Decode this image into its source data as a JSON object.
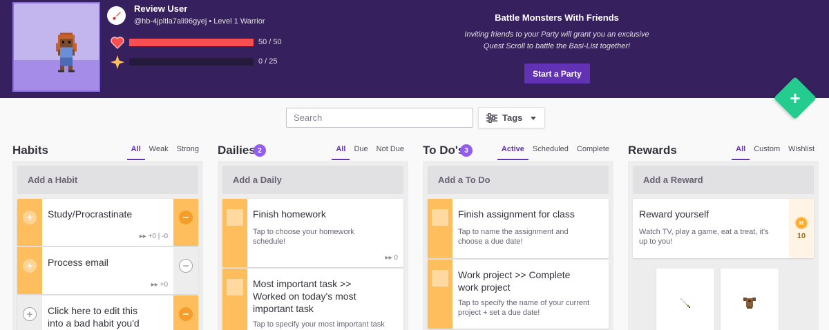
{
  "header": {
    "user_name": "Review User",
    "user_sub": "@hb-4jpltla7ali96gyej • Level 1 Warrior",
    "hp": {
      "text": "50 / 50",
      "fraction": 1.0,
      "color": "#f74e52"
    },
    "xp": {
      "text": "0 / 25",
      "fraction": 0.0,
      "color": "#ffbe5d"
    },
    "party_title": "Battle Monsters With Friends",
    "party_desc_line1": "Inviting friends to your Party will grant you an exclusive",
    "party_desc_line2": "Quest Scroll to battle the Basi-List together!",
    "party_button": "Start a Party",
    "fab_label": "+"
  },
  "toolbar": {
    "search_placeholder": "Search",
    "tags_label": "Tags"
  },
  "habits": {
    "title": "Habits",
    "filters": [
      "All",
      "Weak",
      "Strong"
    ],
    "add_label": "Add a Habit",
    "items": [
      {
        "title": "Study/Procrastinate",
        "meta": "▸▸ +0 | -0"
      },
      {
        "title": "Process email",
        "meta": "▸▸ +0"
      },
      {
        "title_line1": "Click here to edit this",
        "title_line2": "into a bad habit you'd"
      }
    ]
  },
  "dailies": {
    "title": "Dailies",
    "badge": "2",
    "filters": [
      "All",
      "Due",
      "Not Due"
    ],
    "add_label": "Add a Daily",
    "items": [
      {
        "title": "Finish homework",
        "notes_line1": "Tap to choose your homework",
        "notes_line2": "schedule!",
        "meta": "▸▸ 0"
      },
      {
        "title_line1": "Most important task >>",
        "title_line2": "Worked on today's most",
        "title_line3": "important task",
        "notes_line1": "Tap to specify your most important task"
      }
    ]
  },
  "todos": {
    "title": "To Do's",
    "badge": "3",
    "filters": [
      "Active",
      "Scheduled",
      "Complete"
    ],
    "add_label": "Add a To Do",
    "items": [
      {
        "title": "Finish assignment for class",
        "notes_line1": "Tap to name the assignment and",
        "notes_line2": "choose a due date!"
      },
      {
        "title_line1": "Work project >> Complete",
        "title_line2": "work project",
        "notes_line1": "Tap to specify the name of your current",
        "notes_line2": "project + set a due date!"
      }
    ]
  },
  "rewards": {
    "title": "Rewards",
    "filters": [
      "All",
      "Custom",
      "Wishlist"
    ],
    "add_label": "Add a Reward",
    "items": [
      {
        "title": "Reward yourself",
        "notes_line1": "Watch TV, play a game, eat a treat, it's",
        "notes_line2": "up to you!",
        "cost": "10"
      }
    ],
    "shop_items": [
      "sword-item-icon",
      "armor-item-icon"
    ]
  },
  "colors": {
    "header_bg": "#36205d",
    "accent": "#6133b4",
    "habit_orange": "#ffbe5d",
    "fab_green": "#24cc8f"
  }
}
